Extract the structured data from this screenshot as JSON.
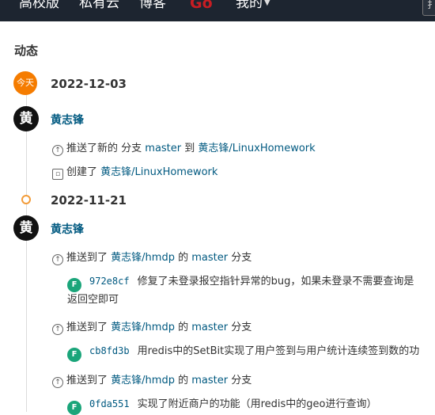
{
  "nav": {
    "items": [
      "高校版",
      "私有云",
      "博客"
    ],
    "go": "Go",
    "mine": "我的",
    "box_icon": "扌"
  },
  "section_title": "动态",
  "today_badge": "今天",
  "groups": [
    {
      "date": "2022-12-03",
      "user": "黄志锋",
      "avatar": "黄",
      "events": [
        {
          "verb": "推送了新的 分支",
          "branch": "master",
          "to": "到",
          "repo": "黄志锋/LinuxHomework"
        },
        {
          "verb": "创建了",
          "repo": "黄志锋/LinuxHomework"
        }
      ]
    },
    {
      "date": "2022-11-21",
      "user": "黄志锋",
      "avatar": "黄",
      "events": [
        {
          "verb": "推送到了",
          "repo": "黄志锋/hmdp",
          "of": "的",
          "branch": "master",
          "suffix": "分支",
          "commit": {
            "badge": "F",
            "sha": "972e8cf",
            "message": "修复了未登录报空指针异常的bug，如果未登录不需要查询是",
            "cont": "返回空即可"
          }
        },
        {
          "verb": "推送到了",
          "repo": "黄志锋/hmdp",
          "of": "的",
          "branch": "master",
          "suffix": "分支",
          "commit": {
            "badge": "F",
            "sha": "cb8fd3b",
            "message": "用redis中的SetBit实现了用户签到与用户统计连续签到数的功"
          }
        },
        {
          "verb": "推送到了",
          "repo": "黄志锋/hmdp",
          "of": "的",
          "branch": "master",
          "suffix": "分支",
          "commit": {
            "badge": "F",
            "sha": "0fda551",
            "message": "实现了附近商户的功能（用redis中的geo进行查询）"
          }
        }
      ]
    }
  ]
}
